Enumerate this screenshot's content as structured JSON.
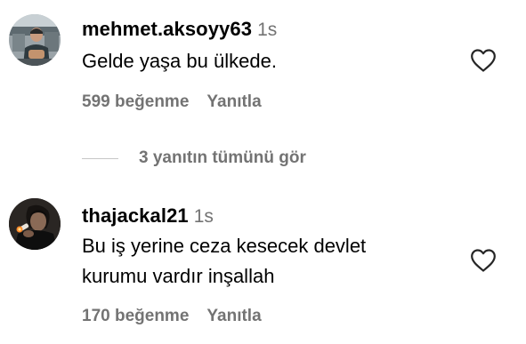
{
  "comments": [
    {
      "username": "mehmet.aksoyy63",
      "time": "1s",
      "text_lines": [
        "Gelde yaşa bu ülkede."
      ],
      "likes": "599 beğenme",
      "reply": "Yanıtla",
      "avatar_icon": "user-photo-avatar",
      "like_icon": "heart-outline-icon"
    },
    {
      "username": "thajackal21",
      "time": "1s",
      "text_lines": [
        "Bu iş yerine ceza kesecek devlet",
        "kurumu vardır inşallah"
      ],
      "likes": "170 beğenme",
      "reply": "Yanıtla",
      "avatar_icon": "user-photo-avatar",
      "like_icon": "heart-outline-icon"
    }
  ],
  "view_replies": {
    "label": "3 yanıtın tümünü gör"
  },
  "colors": {
    "primary_text": "#000000",
    "secondary_text": "#737373",
    "divider": "#c7c7c7",
    "background": "#ffffff"
  }
}
